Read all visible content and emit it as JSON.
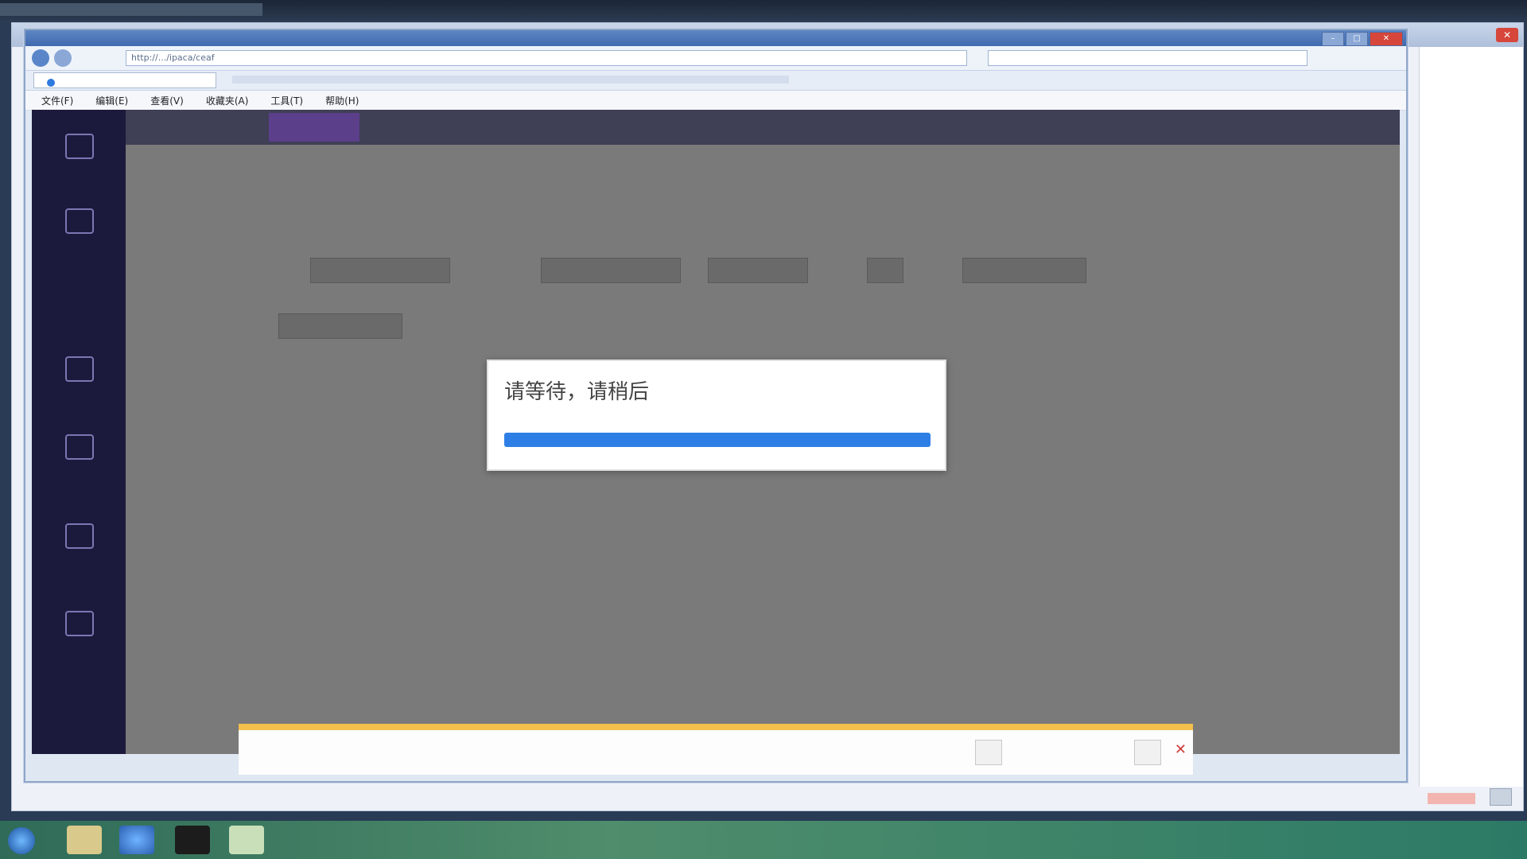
{
  "outer_window": {
    "close_icon": "close-icon"
  },
  "browser": {
    "title": "",
    "address_url": "http://.../ipaca/ceaf",
    "tab_label": "",
    "menu": [
      "文件(F)",
      "编辑(E)",
      "查看(V)",
      "收藏夹(A)",
      "工具(T)",
      "帮助(H)"
    ]
  },
  "app": {
    "sidebar": [
      {
        "label": ""
      },
      {
        "label": ""
      },
      {
        "label": ""
      },
      {
        "label": ""
      },
      {
        "label": ""
      },
      {
        "label": ""
      },
      {
        "label": ""
      }
    ],
    "topbar": {
      "items": [
        "",
        "",
        ""
      ],
      "active": ""
    },
    "chips": [
      "",
      "",
      "",
      "",
      "",
      ""
    ]
  },
  "modal": {
    "message": "请等待，请稍后",
    "progress": 1.0,
    "bar_color": "#2d7fe6"
  },
  "notification": {
    "text": "",
    "buttons": [
      "",
      ""
    ],
    "accent": "#f2c04b"
  },
  "taskbar": {
    "icons": [
      "start-orb",
      "explorer-icon",
      "ie-icon",
      "app-icon",
      "folder-icon"
    ],
    "tray_text": ""
  }
}
